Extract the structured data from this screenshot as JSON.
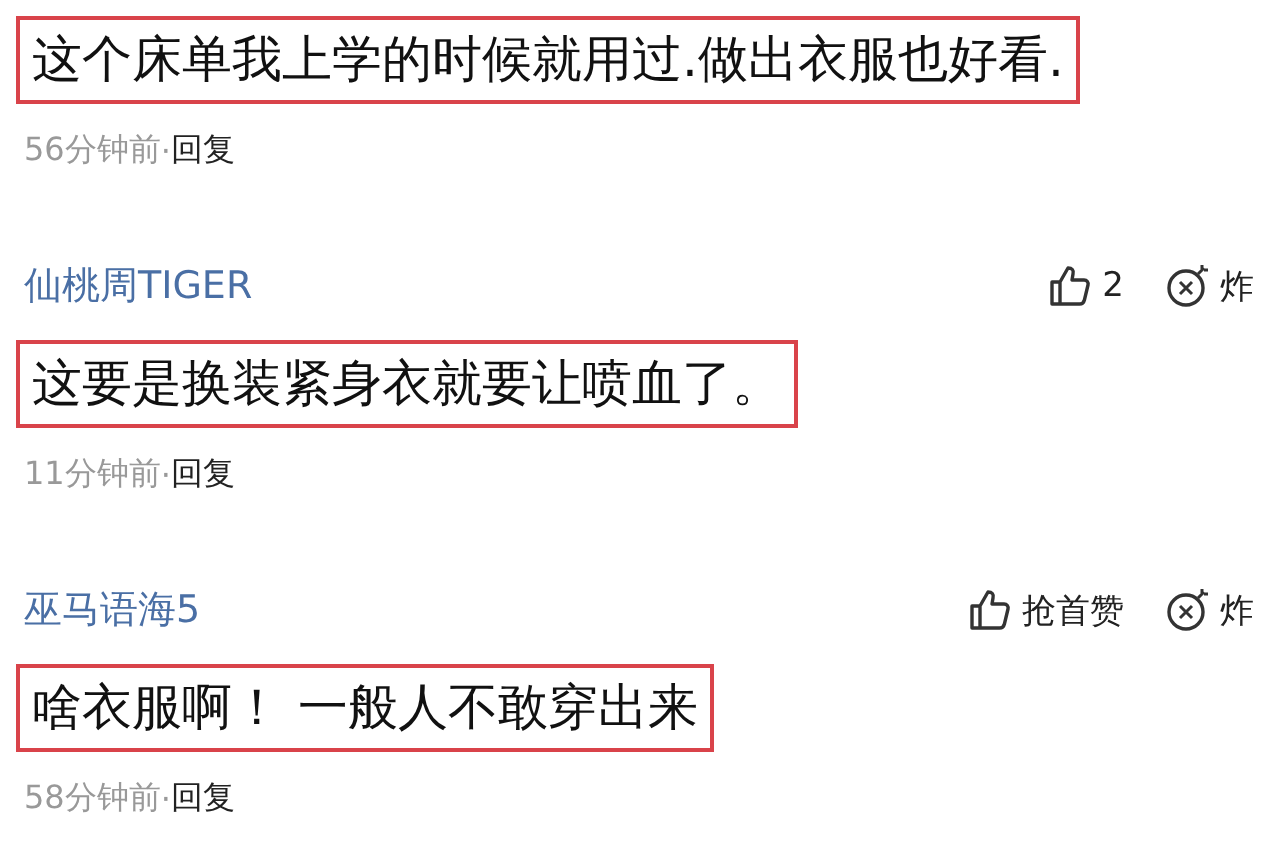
{
  "comments": [
    {
      "text": "这个床单我上学的时候就用过.做出衣服也好看.",
      "time": "56分钟前",
      "separator": "·",
      "reply": "回复"
    },
    {
      "user": "仙桃周TIGER",
      "like": "2",
      "bomb": "炸",
      "text": "这要是换装紧身衣就要让喷血了。",
      "time": "11分钟前",
      "separator": "·",
      "reply": "回复"
    },
    {
      "user": "巫马语海5",
      "like": "抢首赞",
      "bomb": "炸",
      "text": "啥衣服啊！ 一般人不敢穿出来",
      "time": "58分钟前",
      "separator": "·",
      "reply": "回复"
    }
  ]
}
